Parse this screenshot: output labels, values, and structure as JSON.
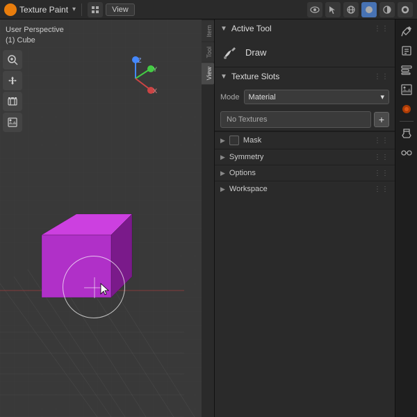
{
  "topbar": {
    "app_icon": "▲",
    "app_name": "Texture Paint",
    "dropdown_arrow": "▾",
    "view_btn": "View",
    "icons": [
      "👁",
      "↗",
      "🌐",
      "⬜",
      "⬛",
      "◯"
    ]
  },
  "viewport": {
    "label_line1": "User Perspective",
    "label_line2": "(1) Cube"
  },
  "viewport_toolbar": {
    "tools": [
      "🔍",
      "✋",
      "🎬",
      "⬛"
    ]
  },
  "n_panel_tabs": [
    {
      "label": "Item",
      "active": false
    },
    {
      "label": "Tool",
      "active": false
    },
    {
      "label": "View",
      "active": true
    }
  ],
  "right_panel": {
    "active_tool": {
      "header": "Active Tool",
      "draw_label": "Draw"
    },
    "texture_slots": {
      "header": "Texture Slots",
      "mode_label": "Mode",
      "mode_value": "Material",
      "no_textures_label": "No Textures",
      "add_btn": "+"
    },
    "collapsibles": [
      {
        "label": "Mask",
        "has_checkbox": true
      },
      {
        "label": "Symmetry",
        "has_checkbox": false
      },
      {
        "label": "Options",
        "has_checkbox": false
      },
      {
        "label": "Workspace",
        "has_checkbox": false
      }
    ]
  },
  "side_icon_bar": {
    "icons": [
      "🔧",
      "🗂",
      "📦",
      "🖼",
      "🔵",
      "🔧",
      "🔗"
    ]
  },
  "colors": {
    "accent_blue": "#4772b3",
    "cube_color": "#b030c8",
    "cube_dark": "#7a1a8a",
    "cube_top": "#cc40e0",
    "bg_viewport": "#393939",
    "bg_panel": "#2a2a2a",
    "grid_line": "rgba(80,80,80,0.4)"
  }
}
